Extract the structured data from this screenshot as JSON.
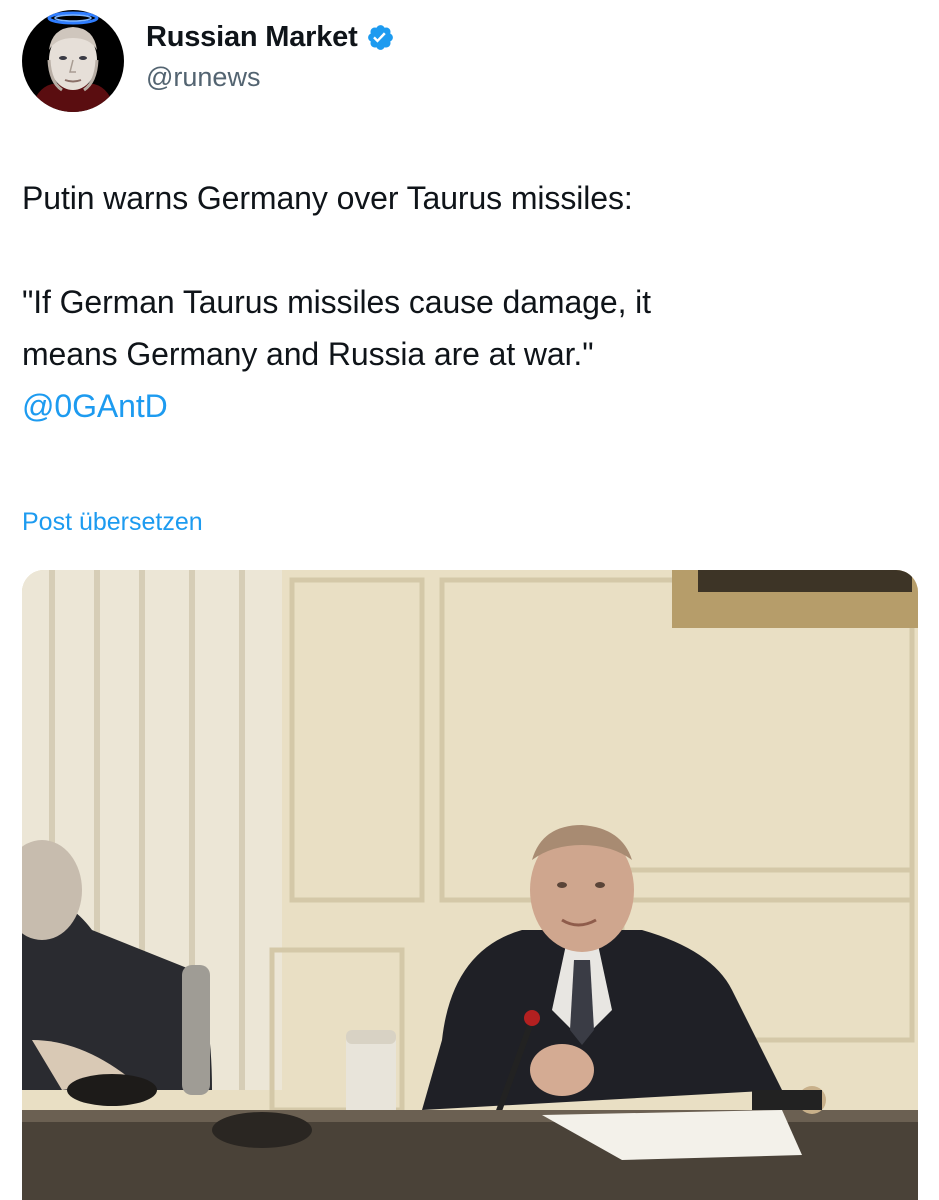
{
  "author": {
    "display_name": "Russian Market",
    "handle": "@runews",
    "verified": true,
    "verified_color": "#1d9bf0",
    "avatar_icon": "portrait-avatar-with-blue-flame-icon"
  },
  "post": {
    "line1": "Putin warns Germany over Taurus missiles:",
    "quote_line1": "\"If German Taurus missiles cause damage, it",
    "quote_line2": "means Germany and Russia are at war.\"",
    "mention": "@0GAntD"
  },
  "translate_label": "Post übersetzen",
  "media": {
    "type": "video-still",
    "icon": "meeting-photo"
  },
  "colors": {
    "link": "#1d9bf0",
    "text": "#0f1419",
    "secondary": "#536471"
  }
}
